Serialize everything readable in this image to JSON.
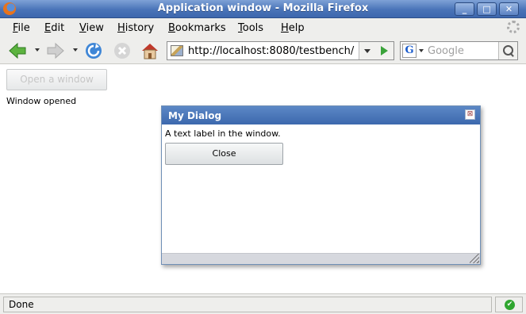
{
  "window": {
    "title": "Application window - Mozilla Firefox"
  },
  "window_controls": {
    "minimize": "_",
    "maximize": "□",
    "close": "✕"
  },
  "menubar": {
    "items": [
      "File",
      "Edit",
      "View",
      "History",
      "Bookmarks",
      "Tools",
      "Help"
    ]
  },
  "navbar": {
    "url": "http://localhost:8080/testbench/",
    "search_placeholder": "Google",
    "search_engine_letter": "G"
  },
  "content": {
    "open_button_label": "Open a window",
    "status_text": "Window opened"
  },
  "dialog": {
    "title": "My Dialog",
    "close_glyph": "⊠",
    "label": "A text label in the window.",
    "close_button_label": "Close"
  },
  "statusbar": {
    "text": "Done",
    "security_glyph": "✔"
  },
  "colors": {
    "titlebar": "#4a74b8",
    "dialog_title": "#3c68ad",
    "go_arrow": "#3aa33a"
  }
}
